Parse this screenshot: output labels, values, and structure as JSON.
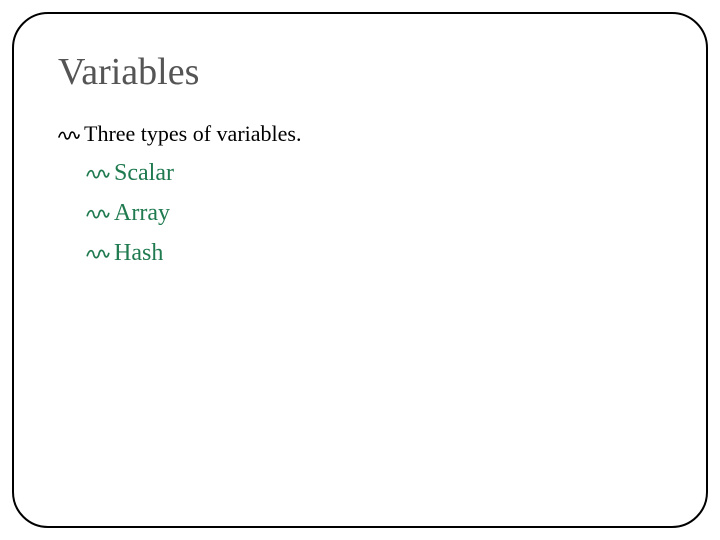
{
  "title": "Variables",
  "intro": "Three types of variables.",
  "items": [
    "Scalar",
    "Array",
    "Hash"
  ]
}
